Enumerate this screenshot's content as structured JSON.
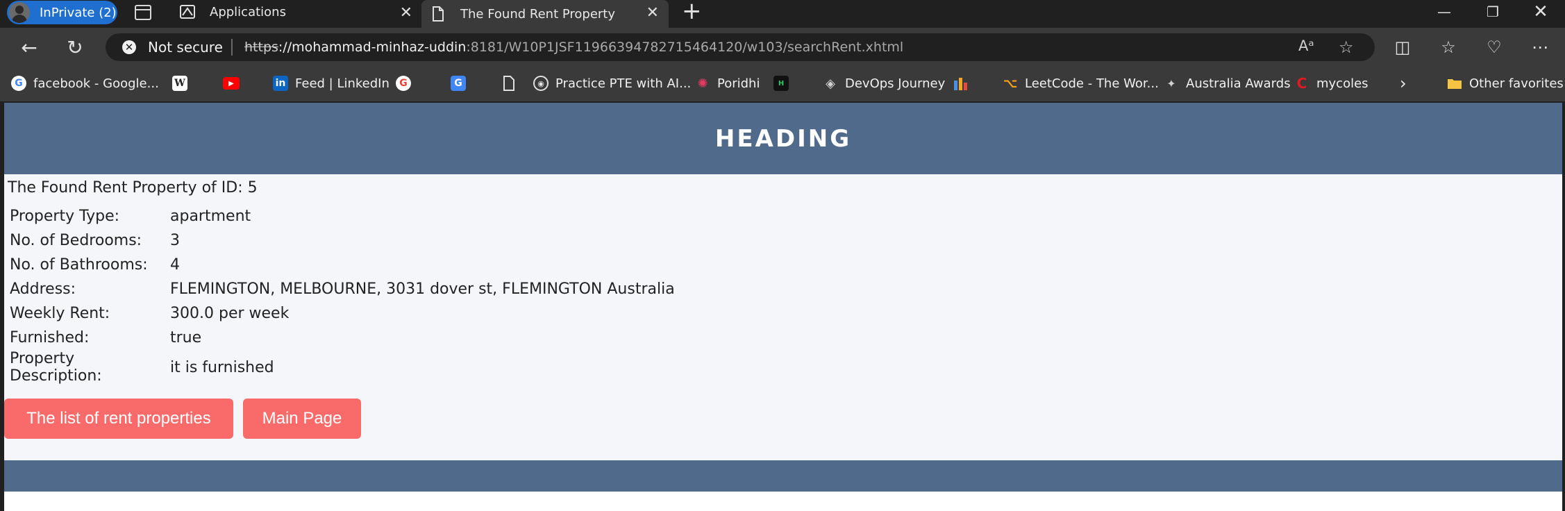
{
  "browser": {
    "profile_label": "InPrivate (2)",
    "tabs": [
      {
        "title": "Applications"
      },
      {
        "title": "The Found Rent Property"
      }
    ],
    "address": {
      "security_label": "Not secure",
      "url_scheme": "https",
      "url_host": "://mohammad-minhaz-uddin",
      "url_rest": ":8181/W10P1JSF11966394782715464120/w103/searchRent.xhtml"
    },
    "favorites": [
      {
        "label": "facebook - Google..."
      },
      {
        "label": ""
      },
      {
        "label": ""
      },
      {
        "label": "Feed | LinkedIn"
      },
      {
        "label": ""
      },
      {
        "label": ""
      },
      {
        "label": ""
      },
      {
        "label": "Practice PTE with AI..."
      },
      {
        "label": "Poridhi"
      },
      {
        "label": ""
      },
      {
        "label": "DevOps Journey"
      },
      {
        "label": ""
      },
      {
        "label": "LeetCode - The Wor..."
      },
      {
        "label": "Australia Awards"
      },
      {
        "label": "mycoles"
      },
      {
        "label": "Other favorites"
      }
    ]
  },
  "page": {
    "heading": "HEADING",
    "found_title": "The Found Rent Property of ID: 5",
    "properties": [
      {
        "label": "Property Type:",
        "value": "apartment"
      },
      {
        "label": "No. of Bedrooms:",
        "value": "3"
      },
      {
        "label": "No. of Bathrooms:",
        "value": "4"
      },
      {
        "label": "Address:",
        "value": "FLEMINGTON, MELBOURNE, 3031 dover st, FLEMINGTON Australia"
      },
      {
        "label": "Weekly Rent:",
        "value": "300.0 per week"
      },
      {
        "label": "Furnished:",
        "value": "true"
      },
      {
        "label": "Property Description:",
        "value": "it is furnished"
      }
    ],
    "buttons": {
      "list_label": "The list of rent properties",
      "main_label": "Main Page"
    }
  },
  "colors": {
    "header_bg": "#4f6a8a",
    "button_bg": "#f96b6b",
    "page_bg": "#f4f6f9"
  }
}
